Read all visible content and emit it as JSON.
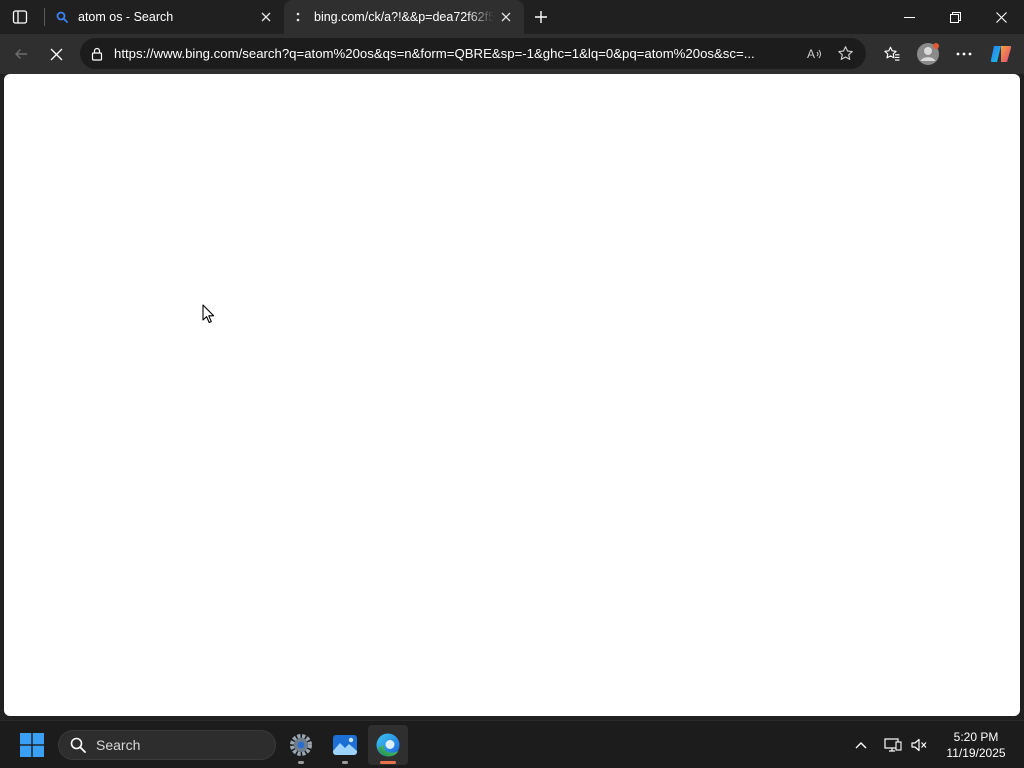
{
  "browser": {
    "tabs": [
      {
        "title": "atom os - Search",
        "favicon": "search-icon",
        "active": false
      },
      {
        "title": "bing.com/ck/a?!&&p=dea72f62f5",
        "favicon": "loading-icon",
        "active": true
      }
    ],
    "address_bar": {
      "url": "https://www.bing.com/search?q=atom%20os&qs=n&form=QBRE&sp=-1&ghc=1&lq=0&pq=atom%20os&sc=..."
    }
  },
  "taskbar": {
    "search_label": "Search",
    "apps": [
      "settings-icon",
      "photos-icon",
      "edge-icon"
    ],
    "clock": {
      "time": "5:20 PM",
      "date": "11/19/2025"
    }
  },
  "colors": {
    "accent": "#0078d4",
    "tab_active_bg": "#2f2f2f",
    "titlebar_bg": "#202020",
    "taskbar_bg": "#1c1c1c"
  }
}
